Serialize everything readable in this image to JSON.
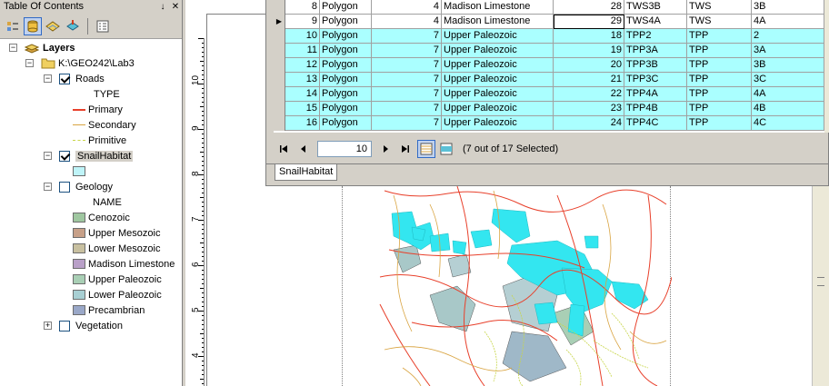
{
  "toc": {
    "title": "Table Of Contents",
    "pin_glyph": "↓",
    "close_glyph": "✕",
    "toolbar_icons": [
      "list-by-drawing-order-icon",
      "list-by-source-icon",
      "list-by-visibility-icon",
      "list-by-selection-icon",
      "options-icon"
    ],
    "layers_label": "Layers",
    "folder_label": "K:\\GEO242\\Lab3",
    "roads": {
      "label": "Roads",
      "field": "TYPE",
      "classes": [
        {
          "label": "Primary",
          "color": "#e8402b",
          "style": "solid"
        },
        {
          "label": "Secondary",
          "color": "#d9a441",
          "style": "solid"
        },
        {
          "label": "Primitive",
          "color": "#c8d64a",
          "style": "dashed"
        }
      ]
    },
    "snail": {
      "label": "SnailHabitat",
      "color": "#bff4f8"
    },
    "geology": {
      "label": "Geology",
      "field": "NAME",
      "classes": [
        {
          "label": "Cenozoic",
          "color": "#9fc7a0"
        },
        {
          "label": "Upper Mesozoic",
          "color": "#c7a088"
        },
        {
          "label": "Lower Mesozoic",
          "color": "#c8c0a0"
        },
        {
          "label": "Madison Limestone",
          "color": "#b9a0c8"
        },
        {
          "label": "Upper Paleozoic",
          "color": "#a9cfb5"
        },
        {
          "label": "Lower Paleozoic",
          "color": "#a8cfd3"
        },
        {
          "label": "Precambrian",
          "color": "#9aa8c8"
        }
      ]
    },
    "vegetation": {
      "label": "Vegetation"
    }
  },
  "ruler": {
    "labels": [
      "10",
      "9",
      "8",
      "7",
      "6",
      "5",
      "4"
    ]
  },
  "attribute_table": {
    "rows": [
      {
        "id": "8",
        "shape": "Polygon",
        "code": "4",
        "name": "Madison Limestone",
        "num": "28",
        "unit": "TWS3B",
        "grp": "TWS",
        "sub": "3B",
        "selected": false,
        "current": false
      },
      {
        "id": "9",
        "shape": "Polygon",
        "code": "4",
        "name": "Madison Limestone",
        "num": "29",
        "unit": "TWS4A",
        "grp": "TWS",
        "sub": "4A",
        "selected": false,
        "current": true
      },
      {
        "id": "10",
        "shape": "Polygon",
        "code": "7",
        "name": "Upper Paleozoic",
        "num": "18",
        "unit": "TPP2",
        "grp": "TPP",
        "sub": "2",
        "selected": true,
        "current": false
      },
      {
        "id": "11",
        "shape": "Polygon",
        "code": "7",
        "name": "Upper Paleozoic",
        "num": "19",
        "unit": "TPP3A",
        "grp": "TPP",
        "sub": "3A",
        "selected": true,
        "current": false
      },
      {
        "id": "12",
        "shape": "Polygon",
        "code": "7",
        "name": "Upper Paleozoic",
        "num": "20",
        "unit": "TPP3B",
        "grp": "TPP",
        "sub": "3B",
        "selected": true,
        "current": false
      },
      {
        "id": "13",
        "shape": "Polygon",
        "code": "7",
        "name": "Upper Paleozoic",
        "num": "21",
        "unit": "TPP3C",
        "grp": "TPP",
        "sub": "3C",
        "selected": true,
        "current": false
      },
      {
        "id": "14",
        "shape": "Polygon",
        "code": "7",
        "name": "Upper Paleozoic",
        "num": "22",
        "unit": "TPP4A",
        "grp": "TPP",
        "sub": "4A",
        "selected": true,
        "current": false
      },
      {
        "id": "15",
        "shape": "Polygon",
        "code": "7",
        "name": "Upper Paleozoic",
        "num": "23",
        "unit": "TPP4B",
        "grp": "TPP",
        "sub": "4B",
        "selected": true,
        "current": false
      },
      {
        "id": "16",
        "shape": "Polygon",
        "code": "7",
        "name": "Upper Paleozoic",
        "num": "24",
        "unit": "TPP4C",
        "grp": "TPP",
        "sub": "4C",
        "selected": true,
        "current": false
      }
    ],
    "record": "10",
    "status": "(7 out of 17 Selected)",
    "tab_label": "SnailHabitat",
    "selection_color": "#aaffff"
  },
  "map": {
    "habitat_color": "#33e6f0",
    "road_primary_color": "#e8402b",
    "road_secondary_color": "#d9a441",
    "road_primitive_color": "#c8d64a"
  }
}
